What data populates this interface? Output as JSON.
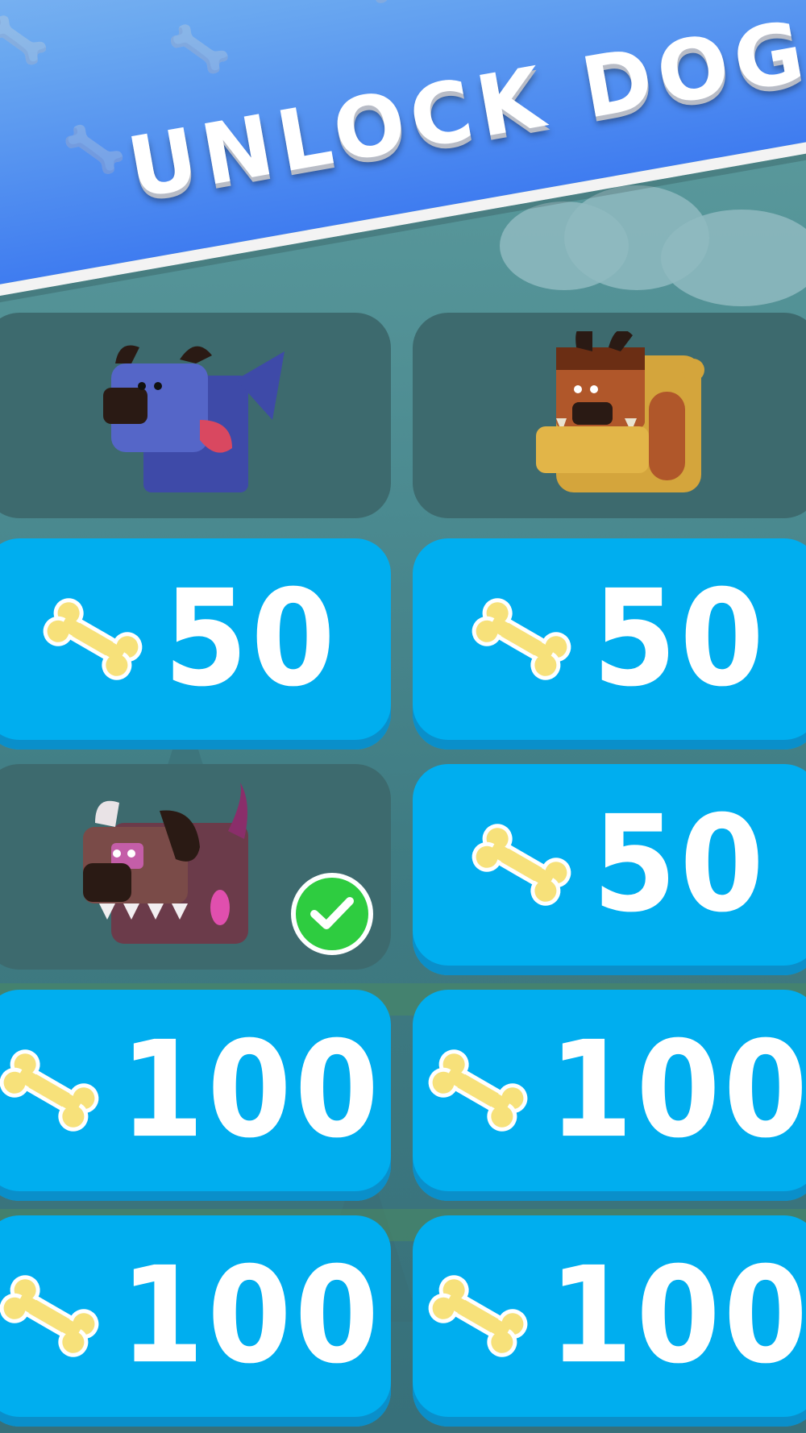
{
  "title": "UNLOCK DOGS",
  "colors": {
    "price_tile": "#00aeef",
    "dog_tile": "#3d6a6e",
    "banner_top": "#9cc9f4",
    "banner_bottom": "#3f7cf0",
    "check": "#2ecc40"
  },
  "icons": {
    "currency": "bone-icon",
    "owned": "checkmark-icon"
  },
  "tiles": [
    {
      "type": "dog",
      "dog": "blue-dog",
      "owned": false
    },
    {
      "type": "dog",
      "dog": "bulldog",
      "owned": false
    },
    {
      "type": "price",
      "price": "50"
    },
    {
      "type": "price",
      "price": "50"
    },
    {
      "type": "dog",
      "dog": "brown-spiky-dog",
      "owned": true
    },
    {
      "type": "price",
      "price": "50"
    },
    {
      "type": "price",
      "price": "100"
    },
    {
      "type": "price",
      "price": "100"
    },
    {
      "type": "price",
      "price": "100"
    },
    {
      "type": "price",
      "price": "100"
    }
  ]
}
